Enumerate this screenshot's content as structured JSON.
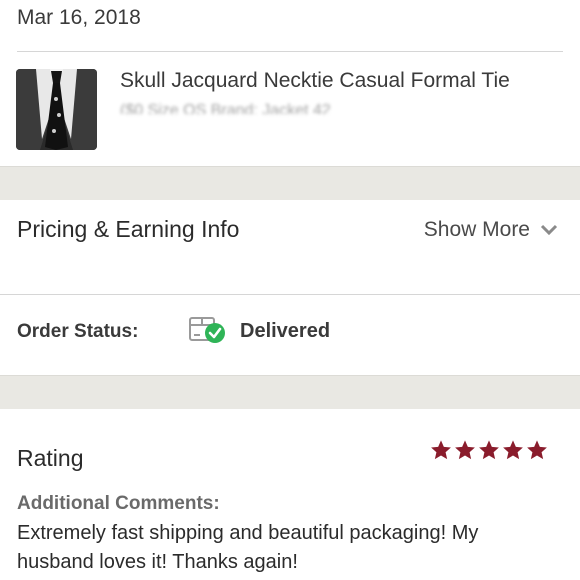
{
  "order": {
    "date": "Mar 16, 2018",
    "product_title": "Skull Jacquard Necktie Casual Formal Tie",
    "product_subtitle": "($0 Size OS Brand: Jacket 42"
  },
  "pricing": {
    "title": "Pricing & Earning Info",
    "show_more_label": "Show More"
  },
  "status": {
    "label": "Order Status:",
    "value": "Delivered",
    "icon": "package-delivered-icon",
    "check_color": "#2fb457"
  },
  "rating": {
    "title": "Rating",
    "stars": 5,
    "star_color": "#8a1c2c",
    "comments_label": "Additional Comments:",
    "comments_text": "Extremely fast shipping and beautiful packaging! My husband loves it! Thanks again!"
  }
}
